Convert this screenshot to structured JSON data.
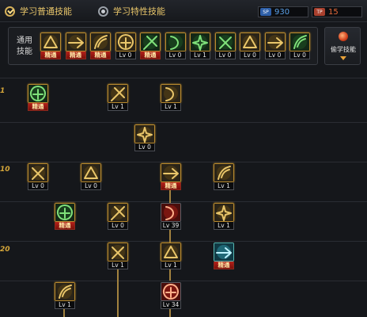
{
  "tabs": [
    {
      "label": "学习普通技能",
      "selected": true
    },
    {
      "label": "学习特性技能",
      "selected": false
    }
  ],
  "currency": [
    {
      "icon": "sp-icon",
      "tag": "SP",
      "value": "930",
      "color": "#5aa0e8",
      "tag_color": "#2e5fa8"
    },
    {
      "icon": "tp-icon",
      "tag": "TP",
      "value": "15",
      "color": "#e86a3a",
      "tag_color": "#a8402e"
    }
  ],
  "shared_label": "通用技能",
  "steal_label": "偷学技能",
  "level_markers": [
    "1",
    "10",
    "20"
  ],
  "shared_skills": [
    {
      "icon": "crouch-strike-icon",
      "lv": "精通",
      "master": true,
      "theme": "gold"
    },
    {
      "icon": "dash-kick-icon",
      "lv": "精通",
      "master": true,
      "theme": "gold"
    },
    {
      "icon": "sprint-icon",
      "lv": "精通",
      "master": true,
      "theme": "gold"
    },
    {
      "icon": "winged-sword-icon",
      "lv": "Lv 0",
      "master": false,
      "theme": "gold"
    },
    {
      "icon": "target-reticle-icon",
      "lv": "精通",
      "master": true,
      "theme": "green"
    },
    {
      "icon": "green-compass-icon",
      "lv": "Lv 0",
      "master": false,
      "theme": "green"
    },
    {
      "icon": "runner-icon",
      "lv": "Lv 1",
      "master": false,
      "theme": "green"
    },
    {
      "icon": "fighter-pose-icon",
      "lv": "Lv 0",
      "master": false,
      "theme": "green"
    },
    {
      "icon": "spiral-orb-icon",
      "lv": "Lv 0",
      "master": false,
      "theme": "gold"
    },
    {
      "icon": "flame-idol-icon",
      "lv": "Lv 0",
      "master": false,
      "theme": "gold"
    },
    {
      "icon": "green-warrior-icon",
      "lv": "Lv 0",
      "master": false,
      "theme": "green"
    }
  ],
  "tree_skills": [
    {
      "icon": "green-grid-icon",
      "lv": "精通",
      "master": true,
      "theme": "green"
    },
    {
      "icon": "dagger-thrust-icon",
      "lv": "Lv 1",
      "master": false,
      "theme": "gold"
    },
    {
      "icon": "claw-slash-icon",
      "lv": "Lv 1",
      "master": false,
      "theme": "gold"
    },
    {
      "icon": "crescent-blade-icon",
      "lv": "Lv 0",
      "master": false,
      "theme": "gold"
    },
    {
      "icon": "whirl-slash-icon",
      "lv": "Lv 0",
      "master": false,
      "theme": "gold"
    },
    {
      "icon": "leap-fighter-icon",
      "lv": "Lv 0",
      "master": false,
      "theme": "gold"
    },
    {
      "icon": "golden-armor-icon",
      "lv": "精通",
      "master": true,
      "theme": "gold"
    },
    {
      "icon": "spear-dive-icon",
      "lv": "Lv 1",
      "master": false,
      "theme": "gold"
    },
    {
      "icon": "green-dagger-icon",
      "lv": "精通",
      "master": true,
      "theme": "green"
    },
    {
      "icon": "wave-slash-icon",
      "lv": "Lv 0",
      "master": false,
      "theme": "gold"
    },
    {
      "icon": "red-burst-icon",
      "lv": "Lv 39",
      "master": false,
      "theme": "red"
    },
    {
      "icon": "crescent-spin-icon",
      "lv": "Lv 1",
      "master": false,
      "theme": "gold"
    },
    {
      "icon": "double-blade-icon",
      "lv": "Lv 1",
      "master": false,
      "theme": "gold"
    },
    {
      "icon": "triple-slash-icon",
      "lv": "Lv 1",
      "master": false,
      "theme": "gold"
    },
    {
      "icon": "teal-wing-icon",
      "lv": "精通",
      "master": true,
      "theme": "teal"
    },
    {
      "icon": "kneeling-warrior-icon",
      "lv": "Lv 1",
      "master": false,
      "theme": "gold"
    },
    {
      "icon": "red-flame-icon",
      "lv": "Lv 34",
      "master": false,
      "theme": "red"
    }
  ]
}
